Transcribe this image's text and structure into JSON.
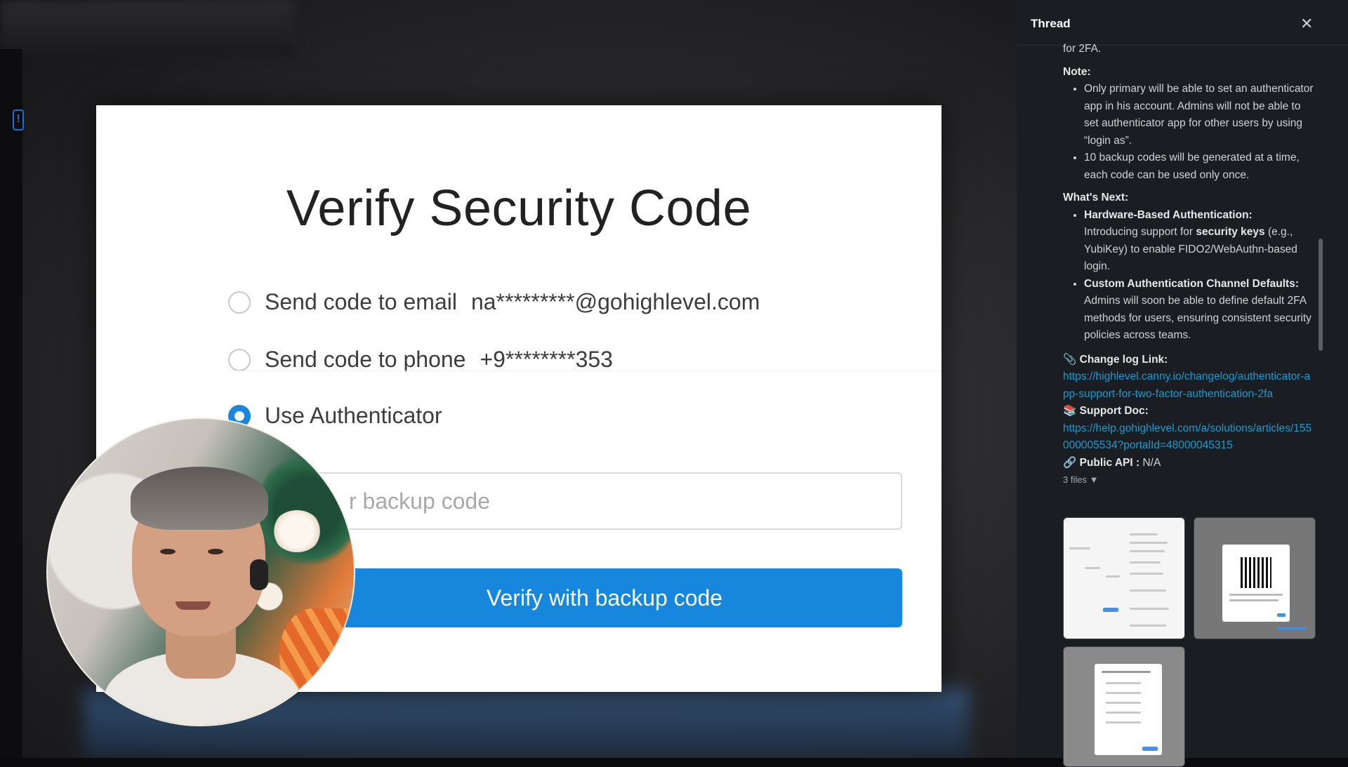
{
  "verify": {
    "title": "Verify Security Code",
    "options": [
      {
        "label": "Send code to email",
        "value": "na*********@gohighlevel.com",
        "selected": false
      },
      {
        "label": "Send code to phone",
        "value": "+9********353",
        "selected": false
      },
      {
        "label": "Use Authenticator",
        "value": "",
        "selected": true
      }
    ],
    "input_placeholder": "r backup code",
    "button_label": "Verify with backup code",
    "accent_color": "#1787dd"
  },
  "thread": {
    "title": "Thread",
    "intro_tail": "for 2FA.",
    "note_label": "Note:",
    "note_items": [
      "Only primary will be able to set an authenticator app in his account. Admins will not be able to set authenticator app for other users by using “login as”.",
      "10 backup codes will be generated at a time, each code can be used only once."
    ],
    "next_label": "What's Next:",
    "next_items": [
      {
        "title": "Hardware-Based Authentication:",
        "pre": "Introducing support for ",
        "bold": "security keys",
        "post": " (e.g., YubiKey) to enable FIDO2/WebAuthn-based login."
      },
      {
        "title": "Custom Authentication Channel Defaults:",
        "text": "Admins will soon be able to define default 2FA methods for users, ensuring consistent security policies across teams."
      }
    ],
    "changelog_label": "Change log Link:",
    "changelog_url": "https://highlevel.canny.io/changelog/authenticator-app-support-for-two-factor-authentication-2fa",
    "support_label": "Support Doc:",
    "support_url": "https://help.gohighlevel.com/a/solutions/articles/155000005534?portalId=48000045315",
    "api_label": "Public API :",
    "api_value": "N/A",
    "files_label": "3 files",
    "icons": [
      "close-icon",
      "paperclip-icon",
      "books-icon",
      "link-icon",
      "caret-down-icon"
    ]
  }
}
